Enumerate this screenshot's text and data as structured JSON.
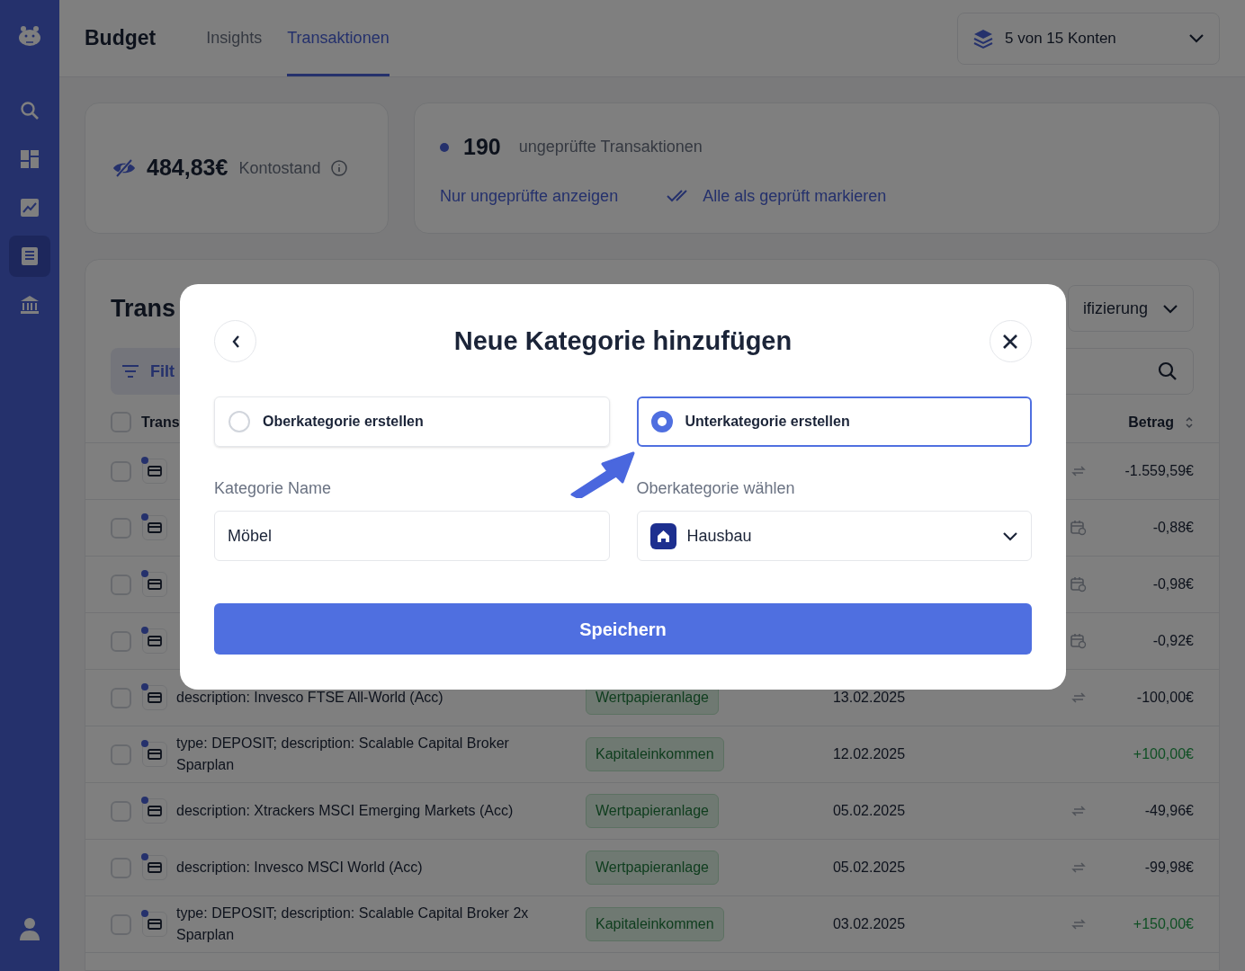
{
  "sidebar": {
    "items": [
      {
        "kind": "search",
        "selected": false
      },
      {
        "kind": "dashboard",
        "selected": false
      },
      {
        "kind": "chart",
        "selected": false
      },
      {
        "kind": "list",
        "selected": true
      },
      {
        "kind": "bank",
        "selected": false
      }
    ]
  },
  "header": {
    "title": "Budget",
    "tabs": [
      {
        "label": "Insights",
        "selected": false
      },
      {
        "label": "Transaktionen",
        "selected": true
      }
    ],
    "accounts": "5 von 15 Konten"
  },
  "balance": {
    "amount": "484,83€",
    "label": "Kontostand"
  },
  "review": {
    "count": "190",
    "text": "ungeprüfte Transaktionen",
    "actions": [
      "Nur ungeprüfte anzeigen",
      "Alle als geprüft markieren"
    ]
  },
  "transactions": {
    "title": "Trans",
    "filter": "Filt",
    "sort_dropdown": "ifizierung",
    "select_all_checked": false,
    "columns": [
      "Trans",
      "Betrag"
    ],
    "rows": [
      {
        "checked": false,
        "kind": "transfer",
        "amount": "-1.559,59€",
        "income": false
      },
      {
        "checked": false,
        "kind": "recurring",
        "amount": "-0,88€",
        "income": false
      },
      {
        "checked": false,
        "kind": "recurring",
        "amount": "-0,98€",
        "income": false
      },
      {
        "checked": false,
        "kind": "recurring",
        "amount": "-0,92€",
        "income": false
      },
      {
        "checked": false,
        "lines": [
          "description: Invesco FTSE All-World (Acc)"
        ],
        "category": "Wertpapieranlage",
        "date": "13.02.2025",
        "kind": "transfer",
        "amount": "-100,00€",
        "income": false
      },
      {
        "checked": false,
        "lines": [
          "type: DEPOSIT; description: Scalable Capital Broker",
          "Sparplan"
        ],
        "category": "Kapitaleinkommen",
        "date": "12.02.2025",
        "amount": "+100,00€",
        "income": true
      },
      {
        "checked": false,
        "lines": [
          "description: Xtrackers MSCI Emerging Markets (Acc)"
        ],
        "category": "Wertpapieranlage",
        "date": "05.02.2025",
        "kind": "transfer",
        "amount": "-49,96€",
        "income": false
      },
      {
        "checked": false,
        "lines": [
          "description: Invesco MSCI World (Acc)"
        ],
        "category": "Wertpapieranlage",
        "date": "05.02.2025",
        "kind": "transfer",
        "amount": "-99,98€",
        "income": false
      },
      {
        "checked": false,
        "lines": [
          "type: DEPOSIT; description: Scalable Capital Broker 2x",
          "Sparplan"
        ],
        "category": "Kapitaleinkommen",
        "date": "03.02.2025",
        "kind": "transfer",
        "amount": "+150,00€",
        "income": true
      }
    ]
  },
  "modal": {
    "title": "Neue Kategorie hinzufügen",
    "options": [
      {
        "label": "Oberkategorie erstellen",
        "selected": false
      },
      {
        "label": "Unterkategorie erstellen",
        "selected": true
      }
    ],
    "name_field": {
      "label": "Kategorie Name",
      "value": "Möbel"
    },
    "parent_field": {
      "label": "Oberkategorie wählen",
      "value": "Hausbau"
    },
    "save": "Speichern"
  }
}
